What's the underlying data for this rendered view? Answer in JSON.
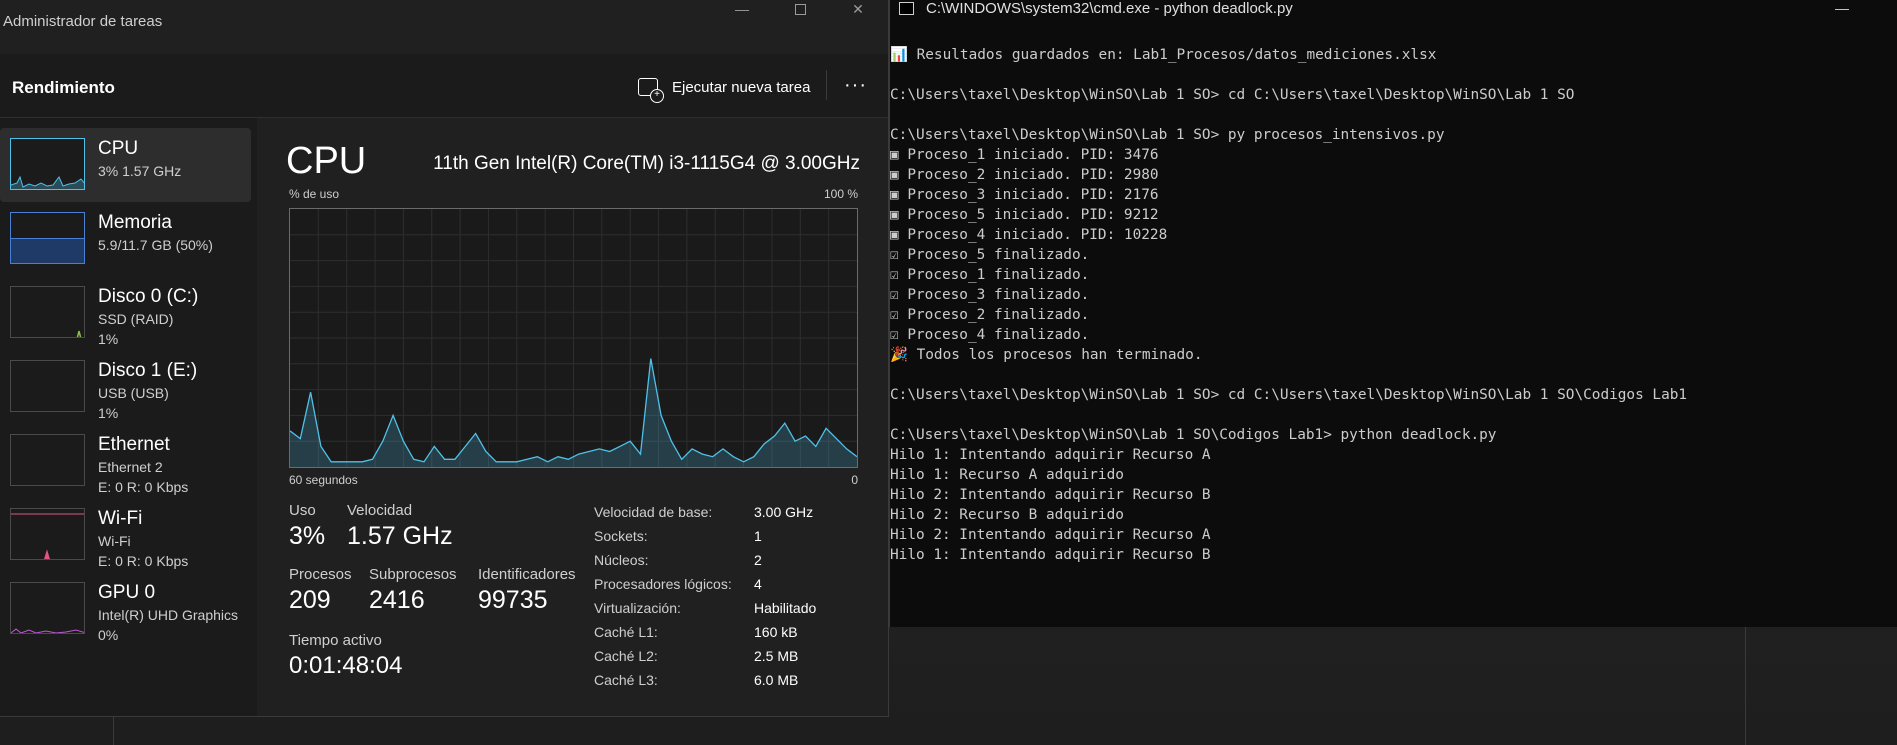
{
  "task_manager": {
    "title": "Administrador de tareas",
    "header": {
      "title": "Rendimiento",
      "run_task": "Ejecutar nueva tarea",
      "more": "···"
    },
    "sidebar": [
      {
        "name": "CPU",
        "line2": "3%  1.57 GHz",
        "line3": ""
      },
      {
        "name": "Memoria",
        "line2": "5.9/11.7 GB (50%)",
        "line3": ""
      },
      {
        "name": "Disco 0 (C:)",
        "line2": "SSD (RAID)",
        "line3": "1%"
      },
      {
        "name": "Disco 1 (E:)",
        "line2": "USB (USB)",
        "line3": "1%"
      },
      {
        "name": "Ethernet",
        "line2": "Ethernet 2",
        "line3": "E: 0 R: 0 Kbps"
      },
      {
        "name": "Wi-Fi",
        "line2": "Wi-Fi",
        "line3": "E: 0 R: 0 Kbps"
      },
      {
        "name": "GPU 0",
        "line2": "Intel(R) UHD Graphics",
        "line3": "0%"
      }
    ],
    "main": {
      "title": "CPU",
      "model": "11th Gen Intel(R) Core(TM) i3-1115G4 @ 3.00GHz",
      "graph": {
        "ylabel": "% de uso",
        "ymax_label": "100 %",
        "xlabel": "60 segundos",
        "xmin_label": "0",
        "values": [
          14,
          11,
          29,
          8,
          2,
          2,
          2,
          2,
          3,
          10,
          20,
          10,
          3,
          2,
          8,
          3,
          3,
          8,
          13,
          6,
          2,
          2,
          2,
          3,
          4,
          2,
          4,
          3,
          5,
          6,
          7,
          6,
          8,
          10,
          5,
          42,
          20,
          10,
          3,
          7,
          5,
          4,
          7,
          4,
          2,
          4,
          9,
          12,
          17,
          10,
          12,
          8,
          15,
          11,
          7,
          4
        ]
      },
      "stats": {
        "uso_label": "Uso",
        "uso": "3%",
        "velocidad_label": "Velocidad",
        "velocidad": "1.57 GHz",
        "procesos_label": "Procesos",
        "procesos": "209",
        "subprocesos_label": "Subprocesos",
        "subprocesos": "2416",
        "identificadores_label": "Identificadores",
        "identificadores": "99735",
        "tiempo_label": "Tiempo activo",
        "tiempo": "0:01:48:04"
      },
      "details": [
        {
          "key": "Velocidad de base:",
          "value": "3.00 GHz"
        },
        {
          "key": "Sockets:",
          "value": "1"
        },
        {
          "key": "Núcleos:",
          "value": "2"
        },
        {
          "key": "Procesadores lógicos:",
          "value": "4"
        },
        {
          "key": "Virtualización:",
          "value": "Habilitado"
        },
        {
          "key": "Caché L1:",
          "value": "160 kB"
        },
        {
          "key": "Caché L2:",
          "value": "2.5 MB"
        },
        {
          "key": "Caché L3:",
          "value": "6.0 MB"
        }
      ]
    }
  },
  "cmd": {
    "title": "C:\\WINDOWS\\system32\\cmd.exe - python  deadlock.py",
    "lines": [
      "📊 Resultados guardados en: Lab1_Procesos/datos_mediciones.xlsx",
      "",
      "C:\\Users\\taxel\\Desktop\\WinSO\\Lab 1 SO> cd C:\\Users\\taxel\\Desktop\\WinSO\\Lab 1 SO",
      "",
      "C:\\Users\\taxel\\Desktop\\WinSO\\Lab 1 SO> py procesos_intensivos.py",
      "▣ Proceso_1 iniciado. PID: 3476",
      "▣ Proceso_2 iniciado. PID: 2980",
      "▣ Proceso_3 iniciado. PID: 2176",
      "▣ Proceso_5 iniciado. PID: 9212",
      "▣ Proceso_4 iniciado. PID: 10228",
      "☑ Proceso_5 finalizado.",
      "☑ Proceso_1 finalizado.",
      "☑ Proceso_3 finalizado.",
      "☑ Proceso_2 finalizado.",
      "☑ Proceso_4 finalizado.",
      "🎉 Todos los procesos han terminado.",
      "",
      "C:\\Users\\taxel\\Desktop\\WinSO\\Lab 1 SO> cd C:\\Users\\taxel\\Desktop\\WinSO\\Lab 1 SO\\Codigos Lab1",
      "",
      "C:\\Users\\taxel\\Desktop\\WinSO\\Lab 1 SO\\Codigos Lab1> python deadlock.py",
      "Hilo 1: Intentando adquirir Recurso A",
      "Hilo 1: Recurso A adquirido",
      "Hilo 2: Intentando adquirir Recurso B",
      "Hilo 2: Recurso B adquirido",
      "Hilo 2: Intentando adquirir Recurso A",
      "Hilo 1: Intentando adquirir Recurso B"
    ]
  },
  "colors": {
    "cpu": "#4fc1e9",
    "memory": "#4a7fd6",
    "disk": "#8bc34a",
    "wifi": "#e0567f",
    "gpu": "#c157d6"
  }
}
